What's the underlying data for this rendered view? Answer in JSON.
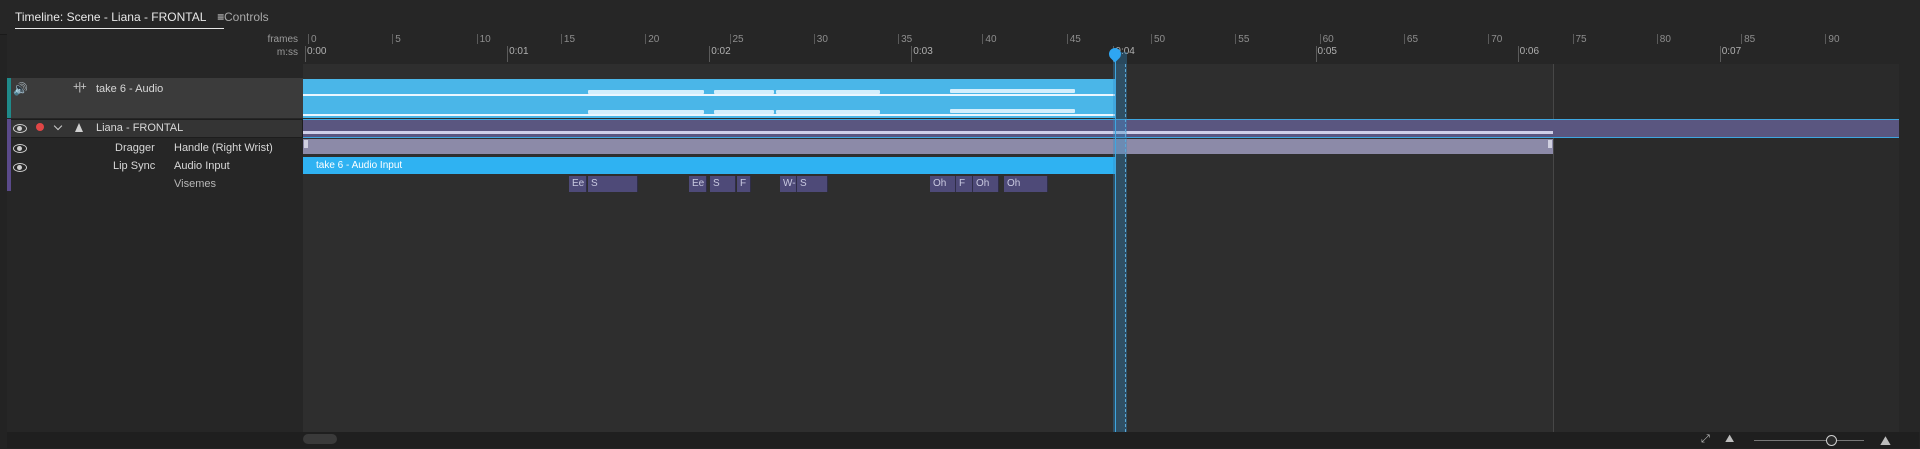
{
  "tabs": {
    "timeline": "Timeline: Scene - Liana - FRONTAL",
    "timeline_menu": "≡",
    "controls": "Controls"
  },
  "ruler": {
    "frames_label": "frames",
    "time_label": "m:ss",
    "frame_ticks": [
      "0",
      "5",
      "10",
      "15",
      "20",
      "25",
      "30",
      "35",
      "40",
      "45",
      "50",
      "55",
      "60",
      "65",
      "70",
      "75",
      "80",
      "85",
      "90"
    ],
    "time_ticks": [
      "0:00",
      "0:01",
      "0:02",
      "0:03",
      "0:04",
      "0:05",
      "0:06",
      "0:07"
    ]
  },
  "tracks": {
    "audio": {
      "label": "take 6 - Audio"
    },
    "puppet": {
      "label": "Liana - FRONTAL"
    },
    "dragger": {
      "label": "Dragger",
      "param": "Handle (Right Wrist)"
    },
    "lipsync": {
      "label": "Lip Sync",
      "param": "Audio Input",
      "bar_label": "take 6 - Audio Input"
    },
    "visemes": {
      "label": "Visemes"
    }
  },
  "visemes": [
    "Ee",
    "S",
    "Ee",
    "S",
    "F",
    "W-",
    "S",
    "Oh",
    "F",
    "Oh",
    "Oh"
  ],
  "colors": {
    "accent": "#2fb2f2",
    "audio": "#4ab6e8",
    "puppet": "#5a5680",
    "viseme": "#4e4a78",
    "record": "#e04646"
  },
  "icons": [
    "speaker-icon",
    "keyframe-arrows-icon",
    "eye-icon",
    "record-icon",
    "chevron-down-icon",
    "puppet-icon",
    "zoom-fit-icon",
    "zoom-out-icon",
    "zoom-in-icon"
  ]
}
